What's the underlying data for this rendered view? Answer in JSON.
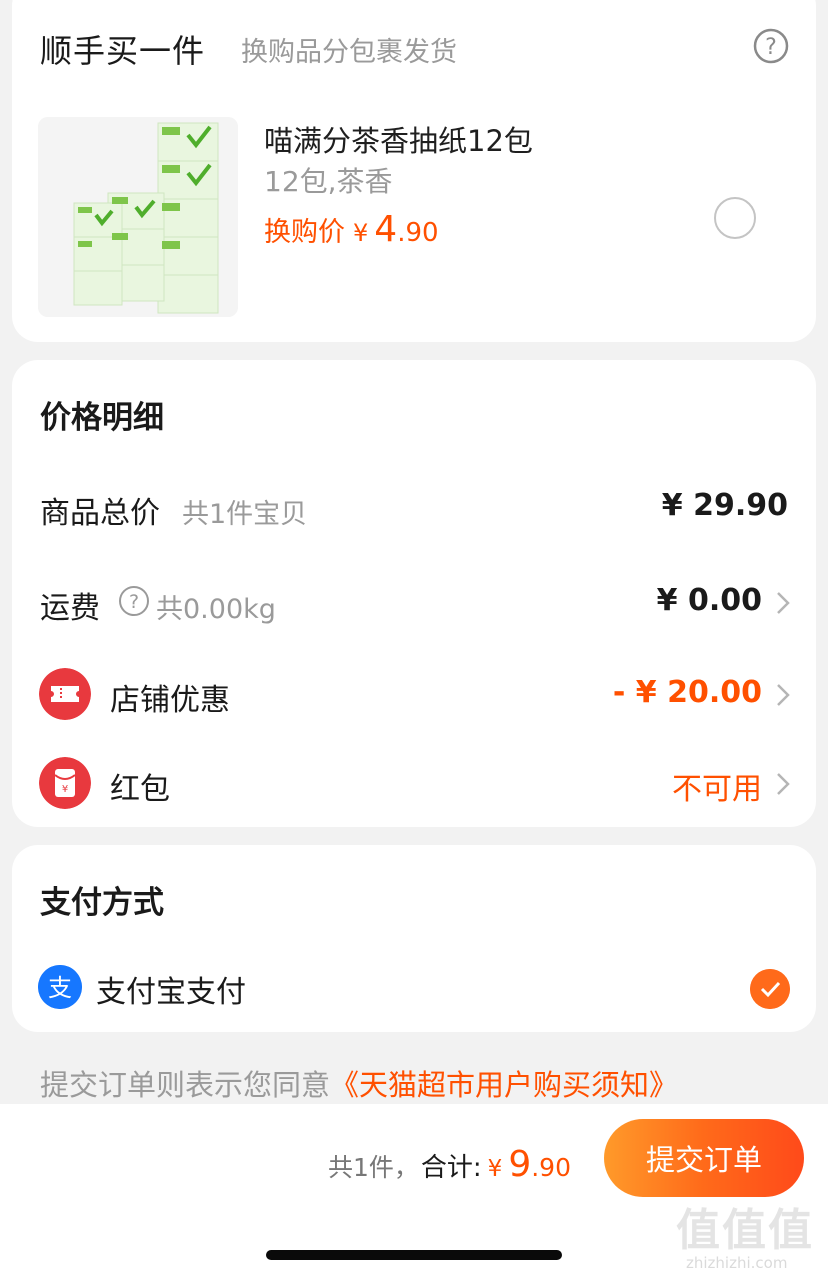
{
  "upsell": {
    "title": "顺手买一件",
    "subtitle": "换购品分包裹发货",
    "help_icon": "question-circle-icon",
    "product": {
      "name": "喵满分茶香抽纸12包",
      "spec": "12包,茶香",
      "price_label": "换购价",
      "currency": "¥",
      "price_int": "4",
      "price_dec": ".90",
      "selected": false
    }
  },
  "price_detail": {
    "title": "价格明细",
    "goods_total": {
      "label": "商品总价",
      "sub": "共1件宝贝",
      "amount": "¥ 29.90"
    },
    "shipping": {
      "label": "运费",
      "sub": "共0.00kg",
      "amount": "¥ 0.00",
      "icon": "question-circle-icon"
    },
    "shop_discount": {
      "label": "店铺优惠",
      "amount": "- ¥ 20.00",
      "icon": "coupon-icon",
      "color": "#e8393e"
    },
    "red_packet": {
      "label": "红包",
      "amount": "不可用",
      "icon": "red-packet-icon",
      "color": "#e8393e"
    }
  },
  "payment": {
    "title": "支付方式",
    "method": {
      "label": "支付宝支付",
      "icon": "alipay-icon",
      "icon_glyph": "支",
      "selected": true
    }
  },
  "agreement": {
    "prefix": "提交订单则表示您同意",
    "link": "《天猫超市用户购买须知》"
  },
  "bottom_bar": {
    "count": "共1件，",
    "sum_label": "合计:",
    "currency": "¥",
    "total_int": "9",
    "total_dec": ".90",
    "submit_label": "提交订单"
  },
  "watermark": {
    "mark": "值值值",
    "text": "zhizhizhi.com"
  },
  "colors": {
    "accent": "#ff5000",
    "alipay": "#1677ff",
    "background": "#f2f2f2"
  }
}
